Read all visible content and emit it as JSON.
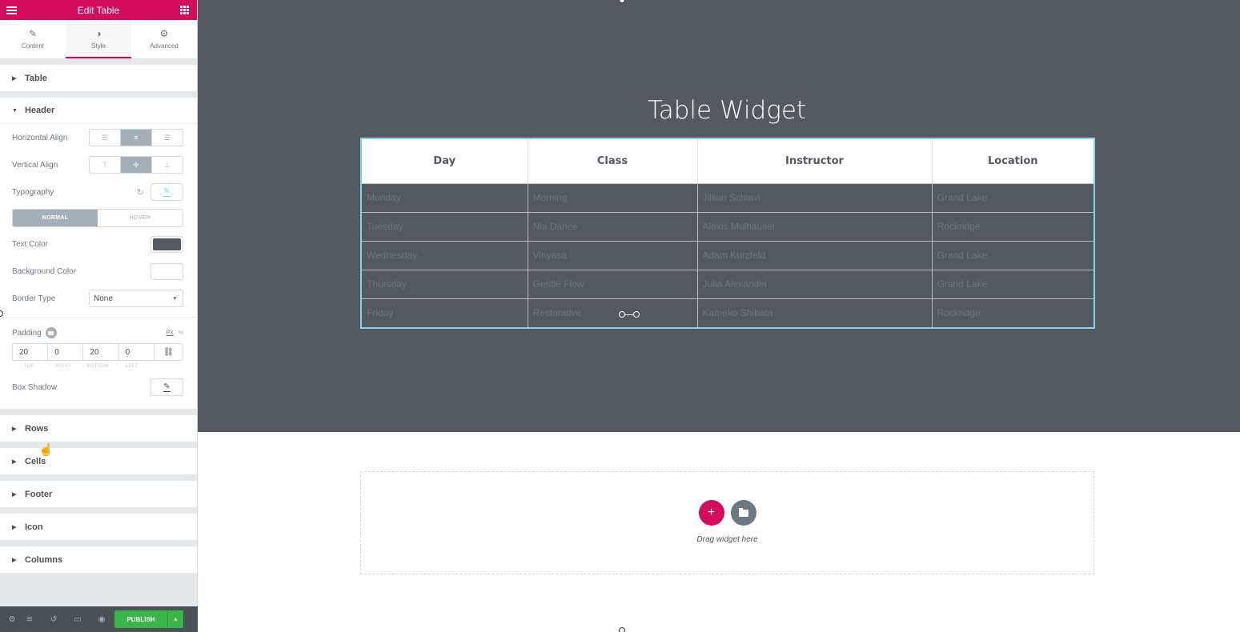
{
  "panel": {
    "title": "Edit Table",
    "tabs": [
      {
        "label": "Content",
        "icon": "pencil-icon",
        "active": false
      },
      {
        "label": "Style",
        "icon": "contrast-icon",
        "active": true
      },
      {
        "label": "Advanced",
        "icon": "gear-icon",
        "active": false
      }
    ],
    "sections": {
      "table": "Table",
      "header": "Header",
      "rows": "Rows",
      "cells": "Cells",
      "footer": "Footer",
      "icon": "Icon",
      "columns": "Columns"
    },
    "header_controls": {
      "horizontal_align_label": "Horizontal Align",
      "horizontal_align_selected": "center",
      "vertical_align_label": "Vertical Align",
      "vertical_align_selected": "middle",
      "typography_label": "Typography",
      "state_tabs": {
        "normal": "NORMAL",
        "hover": "HOVER",
        "active": "normal"
      },
      "text_color_label": "Text Color",
      "text_color_value": "#54595f",
      "background_color_label": "Background Color",
      "background_color_value": "#ffffff",
      "border_type_label": "Border Type",
      "border_type_value": "None",
      "padding_label": "Padding",
      "padding_unit_active": "PX",
      "padding_unit_other": "%",
      "padding": {
        "top": "20",
        "right": "0",
        "bottom": "20",
        "left": "0"
      },
      "padding_labels": {
        "top": "TOP",
        "right": "RIGHT",
        "bottom": "BOTTOM",
        "left": "LEFT"
      },
      "box_shadow_label": "Box Shadow"
    },
    "footer": {
      "publish_label": "PUBLISH",
      "icons": [
        "settings-icon",
        "navigator-layers-icon",
        "history-icon",
        "responsive-desktop-icon",
        "preview-eye-icon"
      ]
    }
  },
  "canvas": {
    "widget_title": "Table Widget",
    "table": {
      "headers": [
        "Day",
        "Class",
        "Instructor",
        "Location"
      ],
      "rows": [
        [
          "Monday",
          "Morning",
          "Jillian Schiavi",
          "Grand Lake"
        ],
        [
          "Tuesday",
          "Nia Dance",
          "Alexis Mulhauser",
          "Rockridge"
        ],
        [
          "Wednesday",
          "Vinyasa",
          "Adam Kurzfeld",
          "Grand Lake"
        ],
        [
          "Thursday",
          "Gentle Flow",
          "Julia Alexander",
          "Grand Lake"
        ],
        [
          "Friday",
          "Restorative",
          "Kameko Shibata",
          "Rockridge"
        ]
      ]
    },
    "dropzone": {
      "text": "Drag widget here",
      "add_label": "+"
    }
  },
  "colors": {
    "brand": "#d30c5c",
    "publish": "#39b54a",
    "canvas_dark": "#54595f",
    "table_border": "#8ad1ec"
  }
}
